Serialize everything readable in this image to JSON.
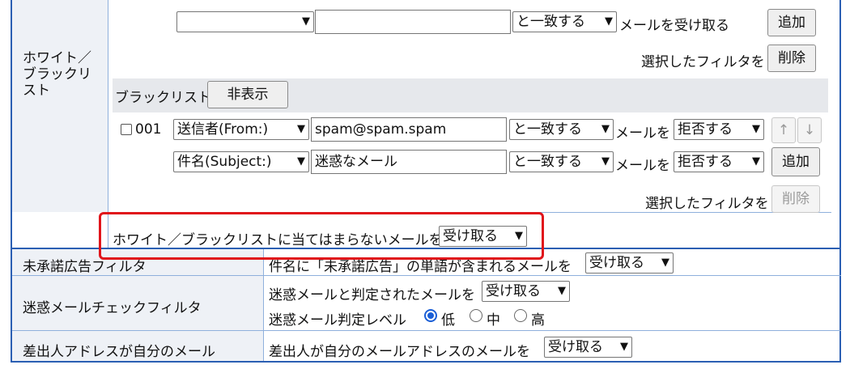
{
  "whitelist_section": {
    "label": "ホワイト／ブラックリスト",
    "white_row": {
      "field_value": "",
      "text_value": "",
      "match_value": "と一致する",
      "action_text": "メールを受け取る",
      "add_label": "追加"
    },
    "white_delete": {
      "label": "選択したフィルタを",
      "button": "削除"
    },
    "blacklist": {
      "title": "ブラックリスト",
      "hide_button": "非表示",
      "rows": [
        {
          "number": "001",
          "field": "送信者(From:)",
          "value": "spam@spam.spam",
          "match": "と一致する",
          "mail_label": "メールを",
          "action": "拒否する"
        },
        {
          "field": "件名(Subject:)",
          "value": "迷惑なメール",
          "match": "と一致する",
          "mail_label": "メールを",
          "action": "拒否する"
        }
      ],
      "up_arrow": "↑",
      "down_arrow": "↓",
      "add_label": "追加",
      "delete_text": "選択したフィルタを",
      "delete_button": "削除"
    },
    "unmatched": {
      "label": "ホワイト／ブラックリストに当てはまらないメールを",
      "value": "受け取る"
    }
  },
  "unapproved_ad": {
    "label": "未承諾広告フィルタ",
    "text": "件名に「未承諾広告」の単語が含まれるメールを",
    "value": "受け取る"
  },
  "spam_check": {
    "label": "迷惑メールチェックフィルタ",
    "text": "迷惑メールと判定されたメールを",
    "value": "受け取る",
    "level_label": "迷惑メール判定レベル",
    "levels": [
      "低",
      "中",
      "高"
    ],
    "selected_level": "低"
  },
  "self_address": {
    "label": "差出人アドレスが自分のメール",
    "text": "差出人が自分のメールアドレスのメールを",
    "value": "受け取る"
  },
  "colors": {
    "border": "#2b5fb3",
    "grid": "#8fb0dc",
    "label_bg": "#eef1f6",
    "highlight": "#e0151b",
    "radio": "#1a5ed6"
  }
}
